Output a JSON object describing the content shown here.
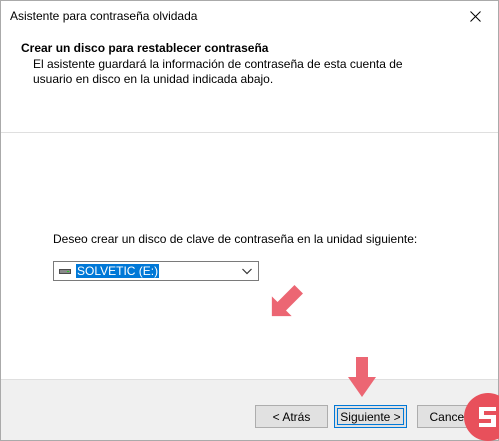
{
  "window": {
    "title": "Asistente para contraseña olvidada"
  },
  "header": {
    "title": "Crear un disco para restablecer contraseña",
    "description": "El asistente guardará la información de contraseña de esta cuenta de usuario en disco en la unidad indicada abajo."
  },
  "content": {
    "prompt": "Deseo crear un disco de clave de contraseña en la unidad siguiente:",
    "drive_select": {
      "selected": "SOLVETIC (E:)",
      "icon": "drive-icon"
    }
  },
  "buttons": {
    "back": "< Atrás",
    "next": "Siguiente >",
    "cancel": "Cancelar"
  },
  "colors": {
    "accent": "#0078d7",
    "annotation_arrow": "#ec6673",
    "logo": "#e8505b"
  }
}
